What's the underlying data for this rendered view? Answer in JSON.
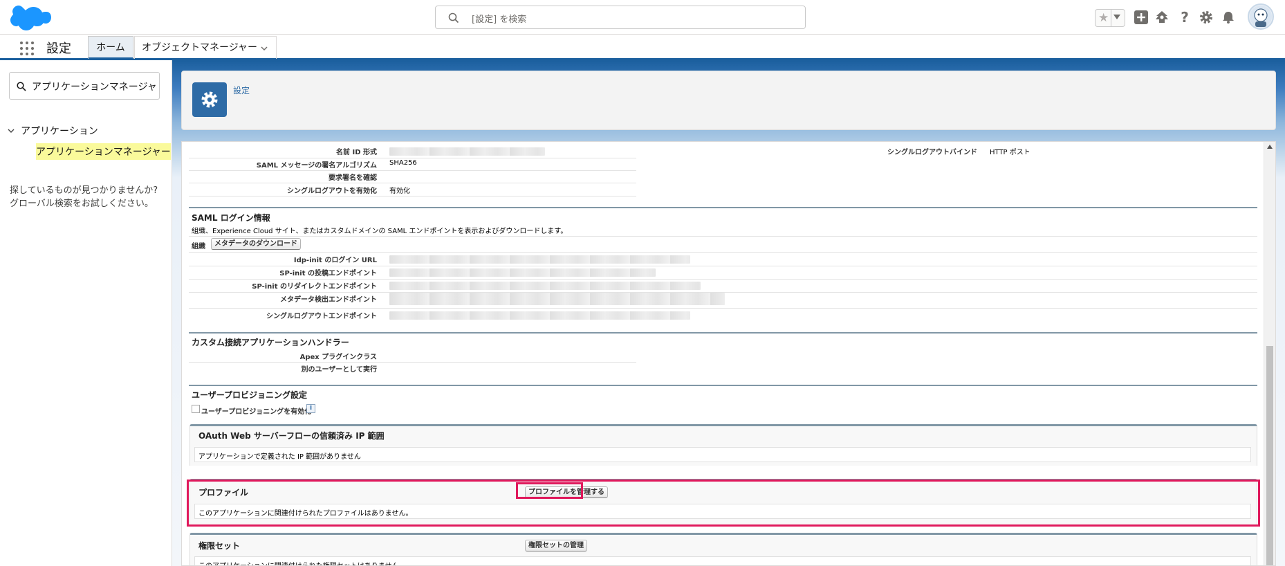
{
  "header": {
    "search_placeholder": "[設定] を検索",
    "icons": [
      "favorites-star-icon",
      "add-icon",
      "trailhead-icon",
      "help-icon",
      "setup-gear-icon",
      "notifications-bell-icon",
      "user-avatar"
    ]
  },
  "context_bar": {
    "app_name": "設定",
    "tabs": [
      {
        "label": "ホーム",
        "active": true
      },
      {
        "label": "オブジェクトマネージャー",
        "active": false
      }
    ]
  },
  "sidebar": {
    "quickfind_value": "アプリケーションマネージャ",
    "tree_parent": "アプリケーション",
    "tree_child": "アプリケーションマネージャー",
    "not_found_line1": "探しているものが見つかりませんか?",
    "not_found_line2": "グローバル検索をお試しください。"
  },
  "setup_header": {
    "title": "設定"
  },
  "content": {
    "top_fields": [
      {
        "label": "名前 ID 形式",
        "value": ""
      },
      {
        "label": "SAML メッセージの署名アルゴリズム",
        "value": "SHA256"
      },
      {
        "label": "要求署名を確認",
        "value": ""
      },
      {
        "label": "シングルログアウトを有効化",
        "value": "有効化"
      }
    ],
    "right_field": {
      "label": "シングルログアウトバインド",
      "value": "HTTP ポスト"
    },
    "saml_login": {
      "title": "SAML ログイン情報",
      "description": "組織、Experience Cloud サイト、またはカスタムドメインの SAML エンドポイントを表示およびダウンロードします。",
      "org_label": "組織",
      "download_button": "メタデータのダウンロード",
      "fields": [
        {
          "label": "Idp-init のログイン URL"
        },
        {
          "label": "SP-init の投稿エンドポイント"
        },
        {
          "label": "SP-init のリダイレクトエンドポイント"
        },
        {
          "label": "メタデータ検出エンドポイント"
        },
        {
          "label": "シングルログアウトエンドポイント"
        }
      ]
    },
    "custom_handler": {
      "title": "カスタム接続アプリケーションハンドラー",
      "fields": [
        {
          "label": "Apex プラグインクラス"
        },
        {
          "label": "別のユーザーとして実行"
        }
      ]
    },
    "user_provisioning": {
      "title": "ユーザープロビジョニング設定",
      "checkbox_label": "ユーザープロビジョニングを有効化",
      "info": "i"
    },
    "oauth_ip": {
      "title": "OAuth Web サーバーフローの信頼済み IP 範囲",
      "empty_text": "アプリケーションで定義された IP 範囲がありません"
    },
    "profiles": {
      "title": "プロファイル",
      "button": "プロファイルを管理する",
      "empty_text": "このアプリケーションに関連付けられたプロファイルはありません。"
    },
    "permission_sets": {
      "title": "権限セット",
      "button": "権限セットの管理",
      "empty_text": "このアプリケーションに関連付けられた権限セットはありません。"
    }
  },
  "colors": {
    "brand_blue": "#1b5f9e",
    "highlight_pink": "#e0195c",
    "tree_highlight": "#fafa9b"
  }
}
